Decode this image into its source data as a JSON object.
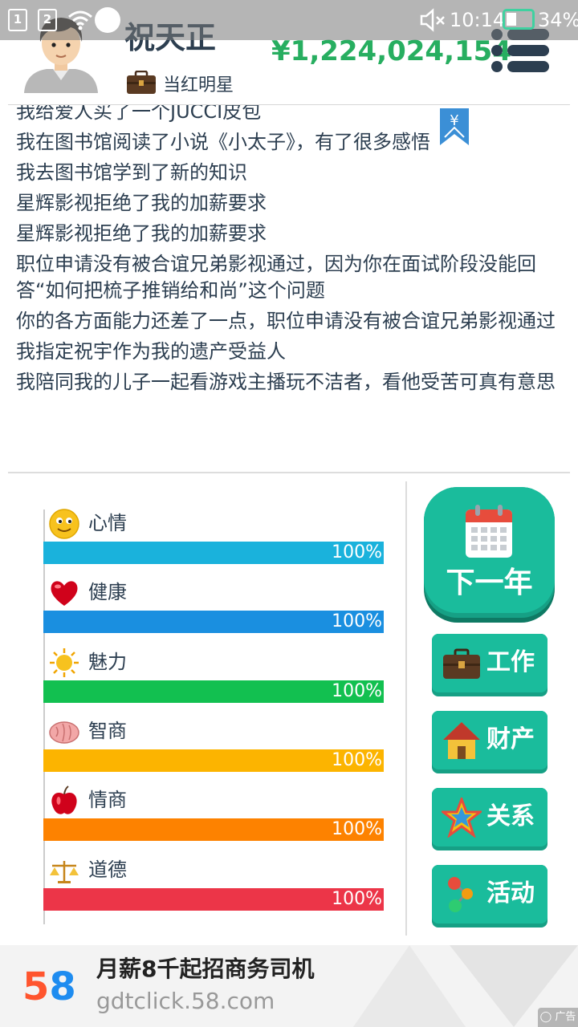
{
  "status_bar": {
    "sim1": "1",
    "sim2": "2",
    "time": "10:14",
    "battery_percent": "34%",
    "battery_level": 0.34
  },
  "header": {
    "name": "祝天正",
    "money": "¥1,224,024,154",
    "job_title": "当红明星",
    "coin_flag_symbol": "¥"
  },
  "log": [
    "我给爱人买了一个JUCCI皮包",
    "我在图书馆阅读了小说《小太子》，有了很多感悟",
    "我去图书馆学到了新的知识",
    "星辉影视拒绝了我的加薪要求",
    "星辉影视拒绝了我的加薪要求",
    "职位申请没有被合谊兄弟影视通过，因为你在面试阶段没能回答“如何把梳子推销给和尚”这个问题",
    "你的各方面能力还差了一点，职位申请没有被合谊兄弟影视通过",
    "我指定祝宇作为我的遗产受益人",
    "我陪同我的儿子一起看游戏主播玩不洁者，看他受苦可真有意思"
  ],
  "stats": [
    {
      "label": "心情",
      "value": "100%",
      "level": 1.0,
      "color": "#1ab2dc",
      "icon": "smiley-icon"
    },
    {
      "label": "健康",
      "value": "100%",
      "level": 1.0,
      "color": "#1a8fe0",
      "icon": "heart-icon"
    },
    {
      "label": "魅力",
      "value": "100%",
      "level": 1.0,
      "color": "#12c050",
      "icon": "sun-icon"
    },
    {
      "label": "智商",
      "value": "100%",
      "level": 1.0,
      "color": "#fcb400",
      "icon": "brain-icon"
    },
    {
      "label": "情商",
      "value": "100%",
      "level": 1.0,
      "color": "#fd8200",
      "icon": "apple-icon"
    },
    {
      "label": "道德",
      "value": "100%",
      "level": 1.0,
      "color": "#ec3548",
      "icon": "scales-icon"
    }
  ],
  "actions": {
    "next_year": "下一年",
    "work": "工作",
    "property": "财产",
    "relations": "关系",
    "activities": "活动"
  },
  "ad": {
    "logo": "58",
    "title": "月薪8千起招商务司机",
    "url": "gdtclick.58.com",
    "badge": "广告"
  },
  "colors": {
    "accent": "#1abc9c",
    "accent_dark": "#16a085",
    "money": "#27ae60",
    "text": "#2c3e50"
  }
}
